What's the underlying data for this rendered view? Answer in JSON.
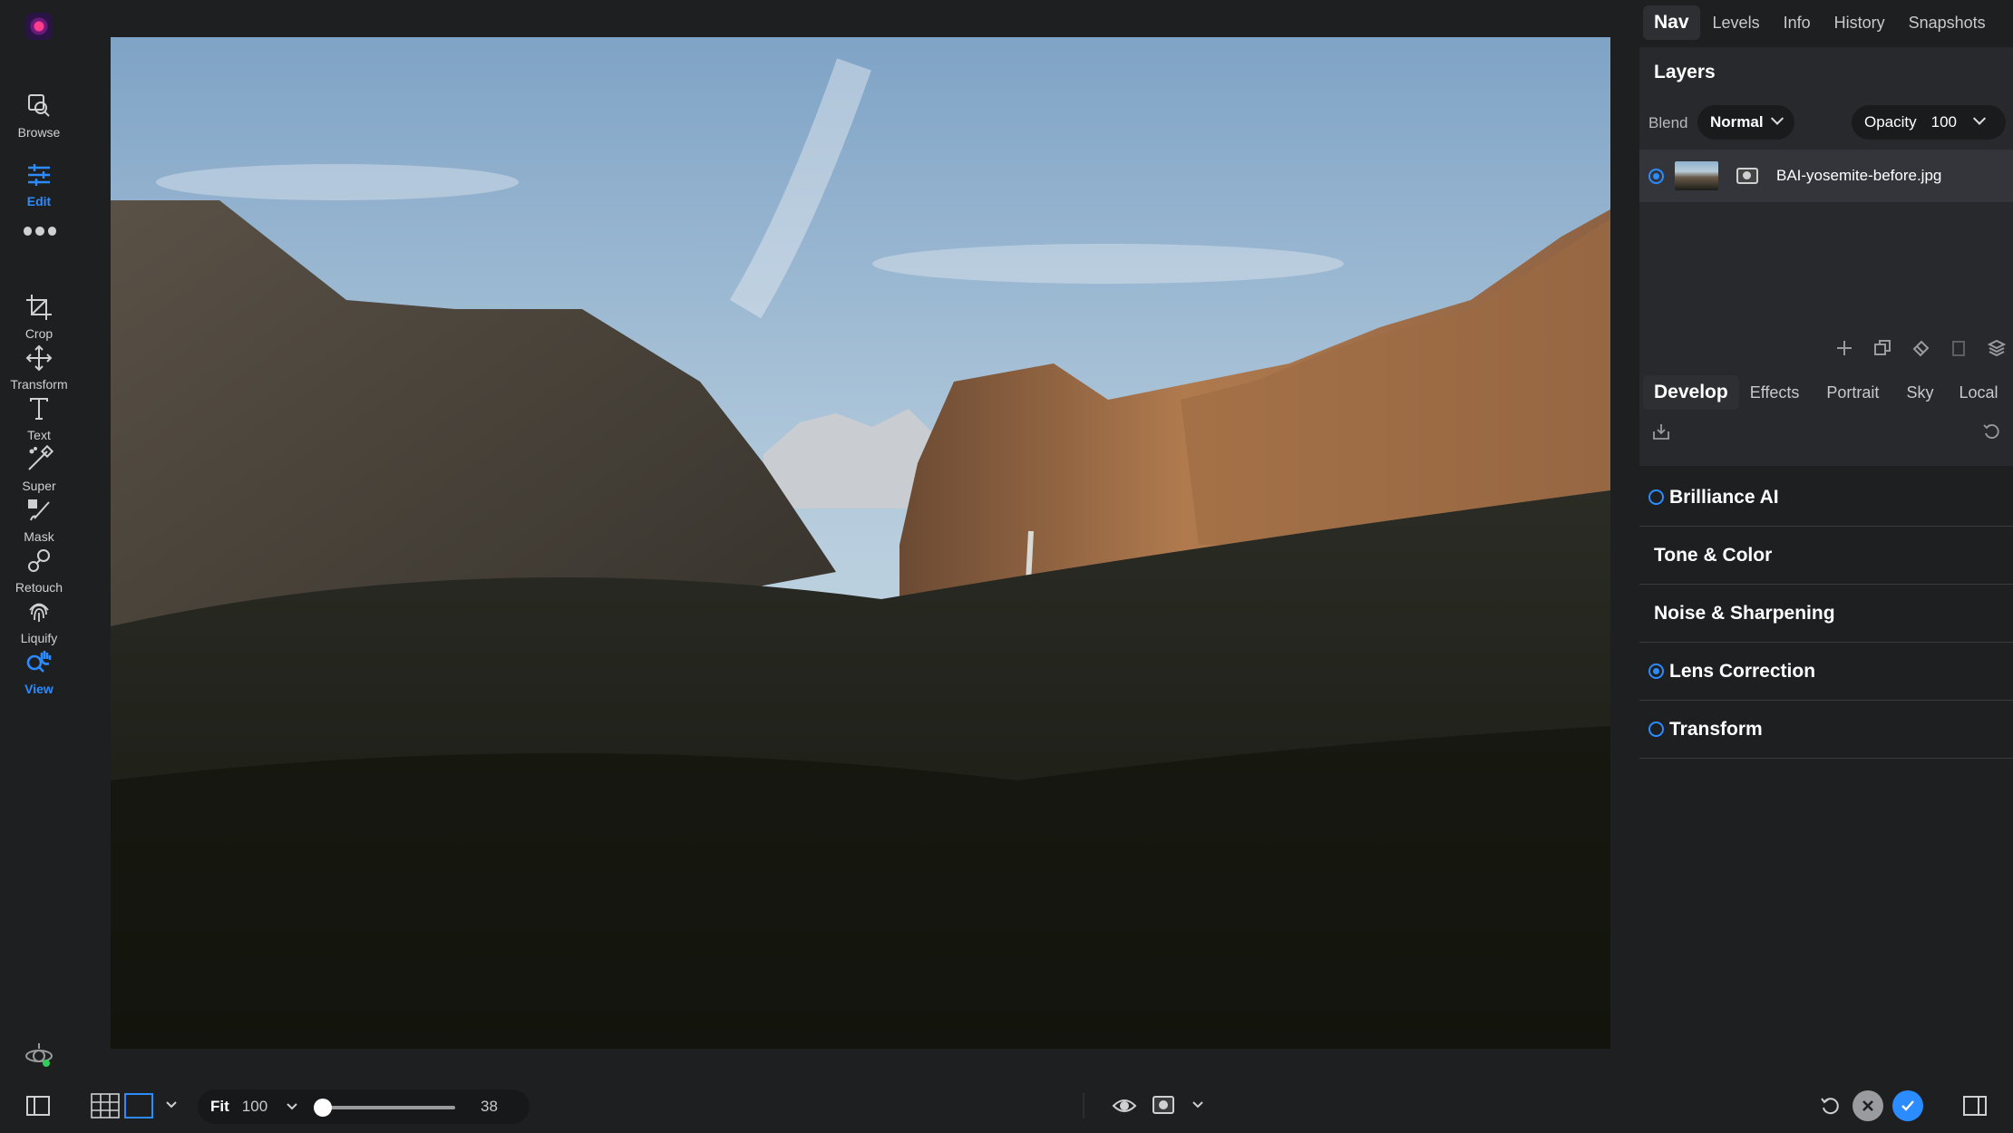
{
  "app": {
    "logo_icon": "app-logo-icon",
    "accent": "#2a8cff"
  },
  "left_toolbar": {
    "items": [
      {
        "name": "browse",
        "label": "Browse",
        "icon": "browse-icon"
      },
      {
        "name": "edit",
        "label": "Edit",
        "icon": "sliders-icon",
        "active": true
      },
      {
        "name": "crop",
        "label": "Crop",
        "icon": "crop-icon"
      },
      {
        "name": "transform",
        "label": "Transform",
        "icon": "move-icon"
      },
      {
        "name": "text",
        "label": "Text",
        "icon": "text-icon"
      },
      {
        "name": "super",
        "label": "Super",
        "icon": "brush-icon"
      },
      {
        "name": "mask",
        "label": "Mask",
        "icon": "mask-brush-icon"
      },
      {
        "name": "retouch",
        "label": "Retouch",
        "icon": "retouch-icon"
      },
      {
        "name": "liquify",
        "label": "Liquify",
        "icon": "fingerprint-icon"
      },
      {
        "name": "view",
        "label": "View",
        "icon": "zoom-hand-icon",
        "active": true
      }
    ]
  },
  "top_tabs": [
    "Nav",
    "Levels",
    "Info",
    "History",
    "Snapshots"
  ],
  "layers": {
    "title": "Layers",
    "blend_label": "Blend",
    "blend_value": "Normal",
    "opacity_label": "Opacity",
    "opacity_value": "100",
    "layer_name": "BAI-yosemite-before.jpg"
  },
  "develop_tabs": [
    "Develop",
    "Effects",
    "Portrait",
    "Sky",
    "Local"
  ],
  "panels": [
    {
      "title": "Brilliance AI",
      "radio": "off"
    },
    {
      "title": "Tone & Color",
      "radio": "none"
    },
    {
      "title": "Noise & Sharpening",
      "radio": "none"
    },
    {
      "title": "Lens Correction",
      "radio": "on"
    },
    {
      "title": "Transform",
      "radio": "off"
    }
  ],
  "bottom": {
    "fit_label": "Fit",
    "zoom_value": "100",
    "slider_value": "38",
    "slider_fraction": 0.0
  }
}
